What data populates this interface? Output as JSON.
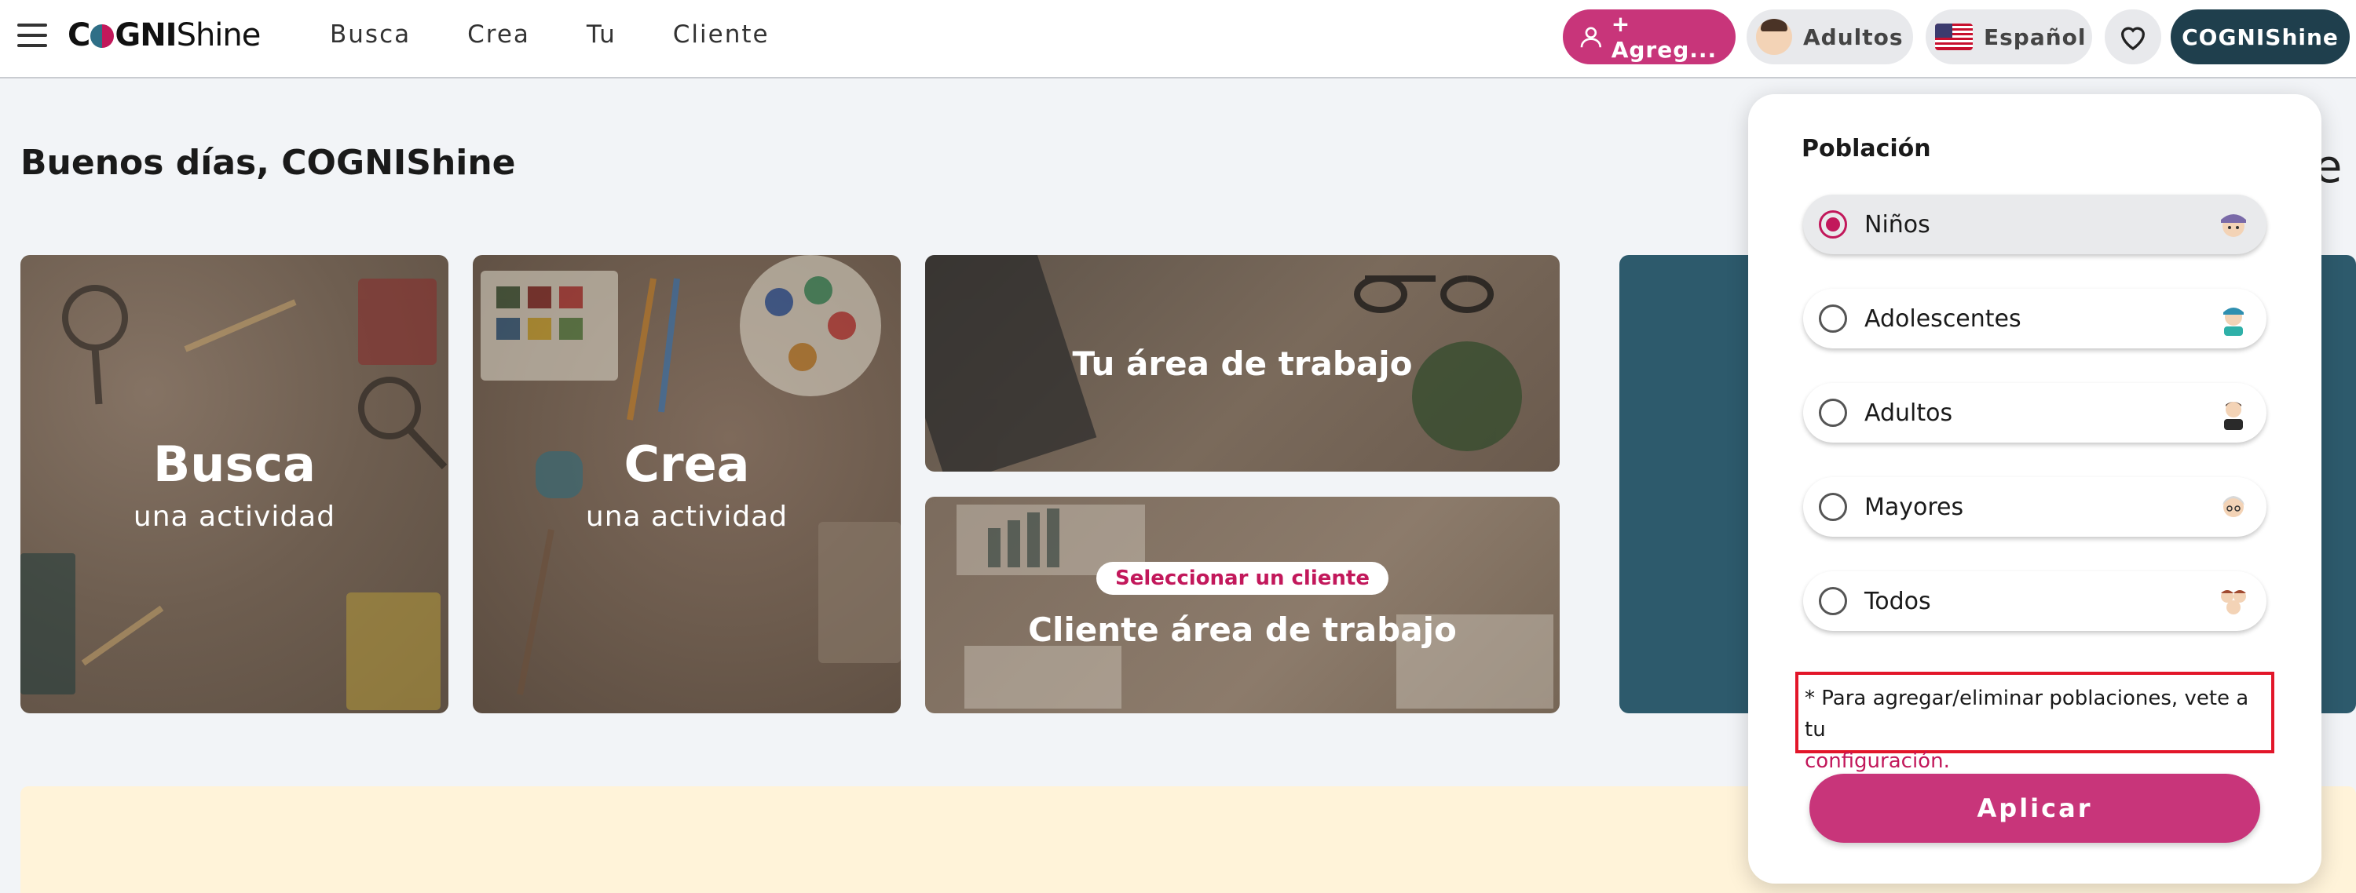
{
  "header": {
    "logo": {
      "prefix": "C",
      "mid": "GNI",
      "suffix": "Shine"
    },
    "nav": [
      "Busca",
      "Crea",
      "Tu",
      "Cliente"
    ],
    "add_button": "+ Agreg...",
    "population_button": "Adultos",
    "language_button": "Español",
    "user_button": "COGNIShine"
  },
  "main": {
    "greeting": "Buenos días, COGNIShine",
    "cards": {
      "busca": {
        "title": "Busca",
        "subtitle": "una actividad"
      },
      "crea": {
        "title": "Crea",
        "subtitle": "una actividad"
      },
      "workspace": {
        "title": "Tu área de trabajo"
      },
      "client": {
        "badge": "Seleccionar un cliente",
        "title": "Cliente área de trabajo"
      }
    },
    "partial_text": "ne"
  },
  "popup": {
    "title": "Población",
    "options": [
      {
        "label": "Niños",
        "icon": "child-avatar-icon",
        "selected": true
      },
      {
        "label": "Adolescentes",
        "icon": "teen-avatar-icon",
        "selected": false
      },
      {
        "label": "Adultos",
        "icon": "adult-avatar-icon",
        "selected": false
      },
      {
        "label": "Mayores",
        "icon": "senior-avatar-icon",
        "selected": false
      },
      {
        "label": "Todos",
        "icon": "group-avatar-icon",
        "selected": false
      }
    ],
    "note_text": "* Para agregar/eliminar poblaciones, vete a tu",
    "note_link": "configuración.",
    "apply_label": "Aplicar"
  },
  "colors": {
    "accent": "#c8357a",
    "dark_teal": "#1f3f4d",
    "teal_card": "#2d5a6c",
    "highlight_border": "#e2162a"
  }
}
